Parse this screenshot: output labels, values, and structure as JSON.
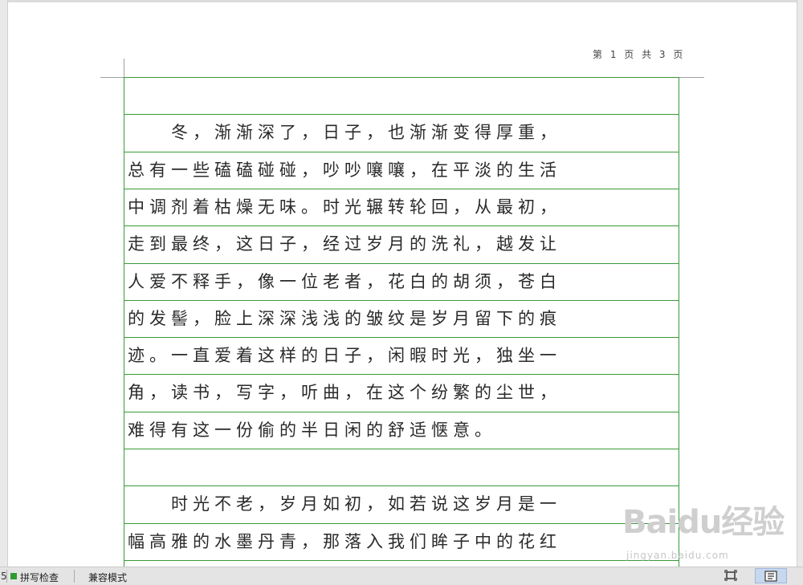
{
  "document": {
    "page_counter": "第 1 页 共 3 页",
    "rows": [
      "",
      "　　冬，渐渐深了，日子，也渐渐变得厚重，",
      "总有一些磕磕碰碰，吵吵嚷嚷，在平淡的生活",
      "中调剂着枯燥无味。时光辗转轮回，从最初，",
      "走到最终，这日子，经过岁月的洗礼，越发让",
      "人爱不释手，像一位老者，花白的胡须，苍白",
      "的发髻，脸上深深浅浅的皱纹是岁月留下的痕",
      "迹。一直爱着这样的日子，闲暇时光，独坐一",
      "角，读书，写字，听曲，在这个纷繁的尘世，",
      "难得有这一份偷的半日闲的舒适惬意。",
      "",
      "　　时光不老，岁月如初，如若说这岁月是一",
      "幅高雅的水墨丹青，那落入我们眸子中的花红"
    ]
  },
  "watermark": {
    "logo": "Baidu经验",
    "url": "jingyan.baidu.com"
  },
  "statusbar": {
    "prefix": "5",
    "spell_check": "拼写检查",
    "compat_mode": "兼容模式",
    "spell_color": "#2e9b2e"
  },
  "colors": {
    "grid_line": "#3a9a3a",
    "active_view": "#c7d7ee"
  }
}
